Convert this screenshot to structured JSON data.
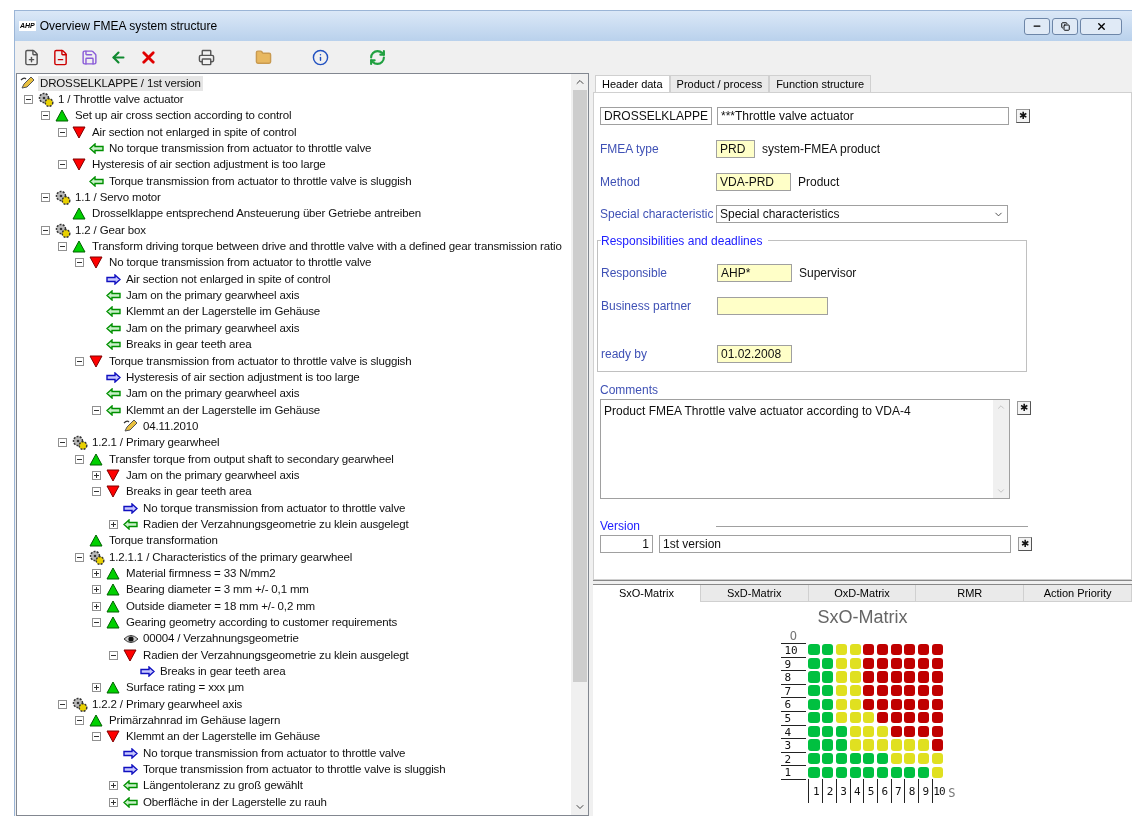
{
  "window": {
    "logo": "AHP",
    "title": "Overview FMEA system structure"
  },
  "tree": {
    "kind": "root",
    "label": "DROSSELKLAPPE / 1st version",
    "selected": true,
    "children": [
      {
        "kind": "component",
        "label": "1 /  Throttle valve actuator",
        "expanded": true,
        "children": [
          {
            "kind": "function",
            "label": "Set up air cross section according to control",
            "expanded": true,
            "children": [
              {
                "kind": "failure",
                "label": "Air section not enlarged in spite of control",
                "expanded": true,
                "children": [
                  {
                    "kind": "cause",
                    "label": "No torque transmission from actuator to throttle valve"
                  }
                ]
              },
              {
                "kind": "failure",
                "label": "Hysteresis of air section adjustment is too large",
                "expanded": true,
                "children": [
                  {
                    "kind": "cause",
                    "label": "Torque transmission from actuator to throttle valve is sluggish"
                  }
                ]
              }
            ]
          },
          {
            "kind": "component",
            "label": "1.1 / Servo motor",
            "expanded": true,
            "children": [
              {
                "kind": "function",
                "label": "Drosselklappe entsprechend Ansteuerung über Getriebe antreiben"
              }
            ]
          },
          {
            "kind": "component",
            "label": "1.2 / Gear box",
            "expanded": true,
            "children": [
              {
                "kind": "function",
                "label": "Transform driving torque between drive and throttle valve with a defined gear transmission ratio",
                "expanded": true,
                "children": [
                  {
                    "kind": "failure",
                    "label": "No torque transmission from actuator to throttle valve",
                    "expanded": true,
                    "children": [
                      {
                        "kind": "effect",
                        "label": "Air section not enlarged in spite of control"
                      },
                      {
                        "kind": "cause",
                        "label": "Jam on the primary gearwheel axis"
                      },
                      {
                        "kind": "cause",
                        "label": "Klemmt an der Lagerstelle im Gehäuse"
                      },
                      {
                        "kind": "cause",
                        "label": "Jam on the primary gearwheel axis"
                      },
                      {
                        "kind": "cause",
                        "label": "Breaks in gear teeth area"
                      }
                    ]
                  },
                  {
                    "kind": "failure",
                    "label": "Torque transmission from actuator to throttle valve is sluggish",
                    "expanded": true,
                    "children": [
                      {
                        "kind": "effect",
                        "label": "Hysteresis of air section adjustment is too large"
                      },
                      {
                        "kind": "cause",
                        "label": "Jam on the primary gearwheel axis"
                      },
                      {
                        "kind": "cause",
                        "label": "Klemmt an der Lagerstelle im Gehäuse",
                        "expanded": true,
                        "children": [
                          {
                            "kind": "date",
                            "label": "04.11.2010"
                          }
                        ]
                      }
                    ]
                  }
                ]
              },
              {
                "kind": "component",
                "label": "1.2.1 / Primary gearwheel",
                "expanded": true,
                "children": [
                  {
                    "kind": "function",
                    "label": "Transfer torque from output shaft to secondary gearwheel",
                    "expanded": true,
                    "children": [
                      {
                        "kind": "failure",
                        "label": "Jam on the primary gearwheel axis",
                        "expanded": false
                      },
                      {
                        "kind": "failure",
                        "label": "Breaks in gear teeth area",
                        "expanded": true,
                        "children": [
                          {
                            "kind": "effect",
                            "label": "No torque transmission from actuator to throttle valve"
                          },
                          {
                            "kind": "cause",
                            "label": "Radien der Verzahnungsgeometrie zu klein ausgelegt",
                            "expanded": false
                          }
                        ]
                      }
                    ]
                  },
                  {
                    "kind": "function",
                    "label": "Torque transformation"
                  },
                  {
                    "kind": "component",
                    "label": "1.2.1.1 / Characteristics of the primary gearwheel",
                    "expanded": true,
                    "children": [
                      {
                        "kind": "function",
                        "label": "Material firmness = 33 N/mm2",
                        "expanded": false
                      },
                      {
                        "kind": "function",
                        "label": "Bearing diameter = 3 mm +/- 0,1 mm",
                        "expanded": false
                      },
                      {
                        "kind": "function",
                        "label": "Outside diameter = 18 mm +/- 0,2 mm",
                        "expanded": false
                      },
                      {
                        "kind": "function",
                        "label": "Gearing geometry according to customer requirements",
                        "expanded": true,
                        "children": [
                          {
                            "kind": "measure",
                            "label": "00004 / Verzahnungsgeometrie"
                          },
                          {
                            "kind": "failure",
                            "label": "Radien der Verzahnungsgeometrie zu klein ausgelegt",
                            "expanded": true,
                            "children": [
                              {
                                "kind": "effect",
                                "label": "Breaks in gear teeth area"
                              }
                            ]
                          }
                        ]
                      },
                      {
                        "kind": "function",
                        "label": "Surface rating = xxx µm",
                        "expanded": false
                      }
                    ]
                  }
                ]
              },
              {
                "kind": "component",
                "label": "1.2.2 / Primary gearwheel axis",
                "expanded": true,
                "children": [
                  {
                    "kind": "function",
                    "label": "Primärzahnrad im Gehäuse lagern",
                    "expanded": true,
                    "children": [
                      {
                        "kind": "failure",
                        "label": "Klemmt an der Lagerstelle im Gehäuse",
                        "expanded": true,
                        "children": [
                          {
                            "kind": "effect",
                            "label": "No torque transmission from actuator to throttle valve"
                          },
                          {
                            "kind": "effect",
                            "label": "Torque transmission from actuator to throttle valve is sluggish"
                          },
                          {
                            "kind": "cause",
                            "label": "Längentoleranz zu groß gewählt",
                            "expanded": false
                          },
                          {
                            "kind": "cause",
                            "label": "Oberfläche in der Lagerstelle zu rauh",
                            "expanded": false
                          }
                        ]
                      }
                    ]
                  }
                ]
              }
            ]
          }
        ]
      }
    ]
  },
  "header_tabs": [
    {
      "label": "Header data",
      "selected": true
    },
    {
      "label": "Product / process",
      "selected": false
    },
    {
      "label": "Function structure",
      "selected": false
    }
  ],
  "header": {
    "code": "DROSSELKLAPPE",
    "name": "***Throttle valve actuator",
    "clear": "✱",
    "fmea_type": {
      "label": "FMEA type",
      "value": "PRD",
      "description": "system-FMEA product"
    },
    "method": {
      "label": "Method",
      "value": "VDA-PRD",
      "description": "Product"
    },
    "special": {
      "label": "Special characteristic",
      "value": "Special characteristics"
    },
    "responsibilities": {
      "title": "Responsibilities and deadlines",
      "responsible": {
        "label": "Responsible",
        "value": "AHP*",
        "description": "Supervisor"
      },
      "business_partner": {
        "label": "Business partner"
      },
      "ready_by": {
        "label": "ready by",
        "value": "01.02.2008"
      }
    },
    "comments": {
      "label": "Comments",
      "value": "Product FMEA Throttle valve actuator according to VDA-4",
      "clear": "✱"
    },
    "version": {
      "label": "Version",
      "number": "1",
      "name": "1st version",
      "clear": "✱"
    }
  },
  "matrix_tabs": [
    {
      "label": "SxO-Matrix",
      "selected": true
    },
    {
      "label": "SxD-Matrix",
      "selected": false
    },
    {
      "label": "OxD-Matrix",
      "selected": false
    },
    {
      "label": "RMR",
      "selected": false
    },
    {
      "label": "Action Priority",
      "selected": false
    }
  ],
  "matrix": {
    "title": "SxO-Matrix",
    "y_axis": "O",
    "x_axis": "S",
    "columns": [
      "1",
      "2",
      "3",
      "4",
      "5",
      "6",
      "7",
      "8",
      "9",
      "10"
    ],
    "rows": [
      {
        "label": "10",
        "cells": [
          {
            "color": "#00c040"
          },
          {
            "color": "#00c040"
          },
          {
            "color": "#e0e020"
          },
          {
            "color": "#e0e020"
          },
          {
            "color": "#c00000"
          },
          {
            "color": "#c00000"
          },
          {
            "color": "#c00000"
          },
          {
            "color": "#c00000"
          },
          {
            "color": "#c00000"
          },
          {
            "color": "#c00000"
          }
        ]
      },
      {
        "label": "9",
        "cells": [
          {
            "color": "#00c040"
          },
          {
            "color": "#00c040"
          },
          {
            "color": "#e0e020"
          },
          {
            "color": "#e0e020"
          },
          {
            "color": "#c00000"
          },
          {
            "color": "#c00000"
          },
          {
            "color": "#c00000"
          },
          {
            "color": "#c00000"
          },
          {
            "color": "#c00000"
          },
          {
            "color": "#c00000"
          }
        ]
      },
      {
        "label": "8",
        "cells": [
          {
            "color": "#00c040"
          },
          {
            "color": "#00c040"
          },
          {
            "color": "#e0e020"
          },
          {
            "color": "#e0e020"
          },
          {
            "color": "#c00000"
          },
          {
            "color": "#c00000"
          },
          {
            "color": "#c00000"
          },
          {
            "color": "#c00000"
          },
          {
            "color": "#c00000"
          },
          {
            "color": "#c00000"
          }
        ]
      },
      {
        "label": "7",
        "cells": [
          {
            "color": "#00c040"
          },
          {
            "color": "#00c040"
          },
          {
            "color": "#e0e020"
          },
          {
            "color": "#e0e020"
          },
          {
            "color": "#c00000"
          },
          {
            "color": "#c00000"
          },
          {
            "color": "#c00000"
          },
          {
            "color": "#c00000"
          },
          {
            "color": "#c00000"
          },
          {
            "color": "#c00000"
          }
        ]
      },
      {
        "label": "6",
        "cells": [
          {
            "color": "#00c040"
          },
          {
            "color": "#00c040"
          },
          {
            "color": "#e0e020"
          },
          {
            "color": "#e0e020"
          },
          {
            "color": "#c00000"
          },
          {
            "color": "#c00000"
          },
          {
            "color": "#c00000"
          },
          {
            "color": "#c00000"
          },
          {
            "color": "#c00000"
          },
          {
            "color": "#c00000"
          }
        ]
      },
      {
        "label": "5",
        "cells": [
          {
            "color": "#00c040"
          },
          {
            "color": "#00c040"
          },
          {
            "color": "#e0e020"
          },
          {
            "color": "#e0e020"
          },
          {
            "color": "#e0e020"
          },
          {
            "color": "#c00000"
          },
          {
            "color": "#c00000"
          },
          {
            "color": "#c00000"
          },
          {
            "color": "#c00000"
          },
          {
            "color": "#c00000"
          }
        ]
      },
      {
        "label": "4",
        "cells": [
          {
            "color": "#00c040"
          },
          {
            "color": "#00c040"
          },
          {
            "color": "#00c040"
          },
          {
            "color": "#e0e020"
          },
          {
            "color": "#e0e020"
          },
          {
            "color": "#e0e020"
          },
          {
            "color": "#c00000"
          },
          {
            "color": "#c00000"
          },
          {
            "color": "#c00000"
          },
          {
            "color": "#c00000"
          }
        ]
      },
      {
        "label": "3",
        "cells": [
          {
            "color": "#00c040"
          },
          {
            "color": "#00c040"
          },
          {
            "color": "#00c040"
          },
          {
            "color": "#e0e020"
          },
          {
            "color": "#e0e020"
          },
          {
            "color": "#e0e020"
          },
          {
            "color": "#e0e020"
          },
          {
            "color": "#e0e020"
          },
          {
            "color": "#e0e020"
          },
          {
            "color": "#c00000"
          }
        ]
      },
      {
        "label": "2",
        "cells": [
          {
            "color": "#00c040"
          },
          {
            "color": "#00c040"
          },
          {
            "color": "#00c040"
          },
          {
            "color": "#00c040"
          },
          {
            "color": "#00c040"
          },
          {
            "color": "#00c040"
          },
          {
            "color": "#e0e020"
          },
          {
            "color": "#e0e020"
          },
          {
            "color": "#e0e020"
          },
          {
            "color": "#e0e020"
          }
        ]
      },
      {
        "label": "1",
        "cells": [
          {
            "color": "#00c040"
          },
          {
            "color": "#00c040"
          },
          {
            "color": "#00c040"
          },
          {
            "color": "#00c040"
          },
          {
            "color": "#00c040"
          },
          {
            "color": "#00c040"
          },
          {
            "color": "#00c040"
          },
          {
            "color": "#00c040"
          },
          {
            "color": "#00c040"
          },
          {
            "color": "#e0e020"
          }
        ]
      }
    ]
  }
}
